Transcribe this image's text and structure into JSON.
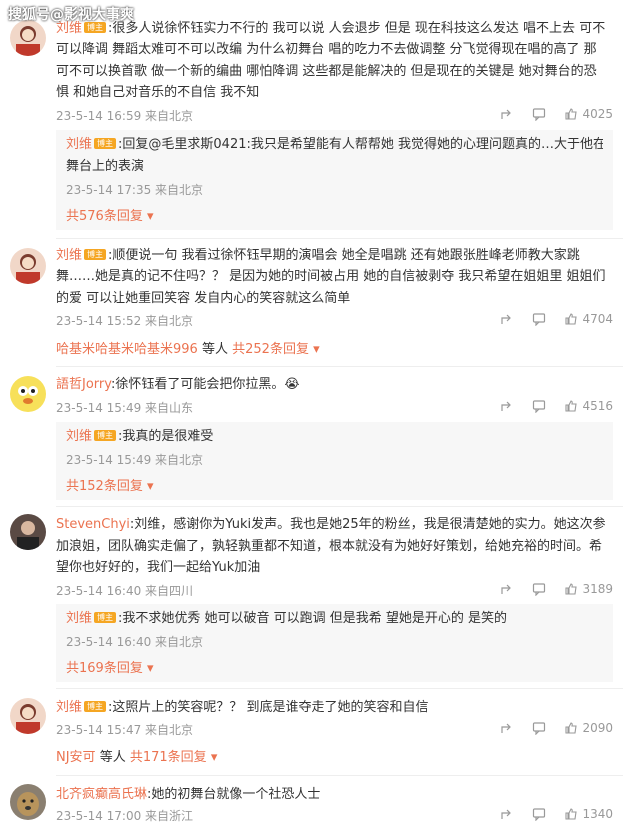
{
  "watermark": "搜狐号@影视大事爽",
  "comments": [
    {
      "name": "刘维",
      "badge": "博主",
      "lines": [
        ":很多人说徐怀钰实力不行的  我可以说  人会退步  但是  现在科技这么发达  唱不上去  可不",
        "可以降调  舞蹈太难可不可以改编  为什么初舞台  唱的吃力不去做调整  分飞觉得现在唱的高了  那",
        "可不可以换首歌  做一个新的编曲  哪怕降调  这些都是能解决的  但是现在的关键是  她对舞台的恐",
        "惧  和她自己对音乐的不自信  我不知"
      ],
      "time": "23-5-14 16:59 来自北京",
      "likes": "4025",
      "reply": {
        "name": "刘维",
        "badge": "博主",
        "lines": [
          ":回复@毛里求斯0421:我只是希望能有人帮帮她  我觉得她的心理问题真的…大于他在",
          "舞台上的表演"
        ],
        "time": "23-5-14 17:35 来自北京",
        "more": "共576条回复"
      }
    },
    {
      "name": "刘维",
      "badge": "博主",
      "lines": [
        ":顺便说一句  我看过徐怀钰早期的演唱会  她全是唱跳  还有她跟张胜峰老师教大家跳",
        "舞……她是真的记不住吗？？  是因为她的时间被占用  她的自信被剥夺  我只希望在姐姐里  姐姐们",
        "的爱  可以让她重回笑容  发自内心的笑容就这么简单"
      ],
      "time": "23-5-14 15:52 来自北京",
      "likes": "4704",
      "thread": {
        "names": "哈基米哈基米哈基米996",
        "suffix": "等人",
        "more": "共252条回复"
      }
    },
    {
      "name": "語哲Jorry",
      "lines": [
        ":徐怀钰看了可能会把你拉黑。😭"
      ],
      "time": "23-5-14 15:49 来自山东",
      "likes": "4516",
      "reply": {
        "name": "刘维",
        "badge": "博主",
        "lines": [
          ":我真的是很难受"
        ],
        "time": "23-5-14 15:49 来自北京",
        "more": "共152条回复"
      }
    },
    {
      "name": "StevenChyi",
      "lines": [
        ":刘维，感谢你为Yuki发声。我也是她25年的粉丝，我是很清楚她的实力。她这次参",
        "加浪姐，团队确实走偏了，孰轻孰重都不知道，根本就没有为她好好策划，给她充裕的时间。希",
        "望你也好好的，我们一起给Yuk加油"
      ],
      "time": "23-5-14 16:40 来自四川",
      "likes": "3189",
      "reply": {
        "name": "刘维",
        "badge": "博主",
        "lines": [
          ":我不求她优秀  她可以破音  可以跑调  但是我希  望她是开心的  是笑的"
        ],
        "time": "23-5-14 16:40 来自北京",
        "more": "共169条回复"
      }
    },
    {
      "name": "刘维",
      "badge": "博主",
      "lines": [
        ":这照片上的笑容呢？？  到底是谁夺走了她的笑容和自信"
      ],
      "time": "23-5-14 15:47 来自北京",
      "likes": "2090",
      "thread": {
        "names": "NJ安可",
        "suffix": "等人",
        "more": "共171条回复"
      }
    },
    {
      "name": "北齐疯癫高氏琳",
      "lines": [
        ":她的初舞台就像一个社恐人士"
      ],
      "time": "23-5-14 17:00 来自浙江",
      "likes": "1340"
    }
  ]
}
